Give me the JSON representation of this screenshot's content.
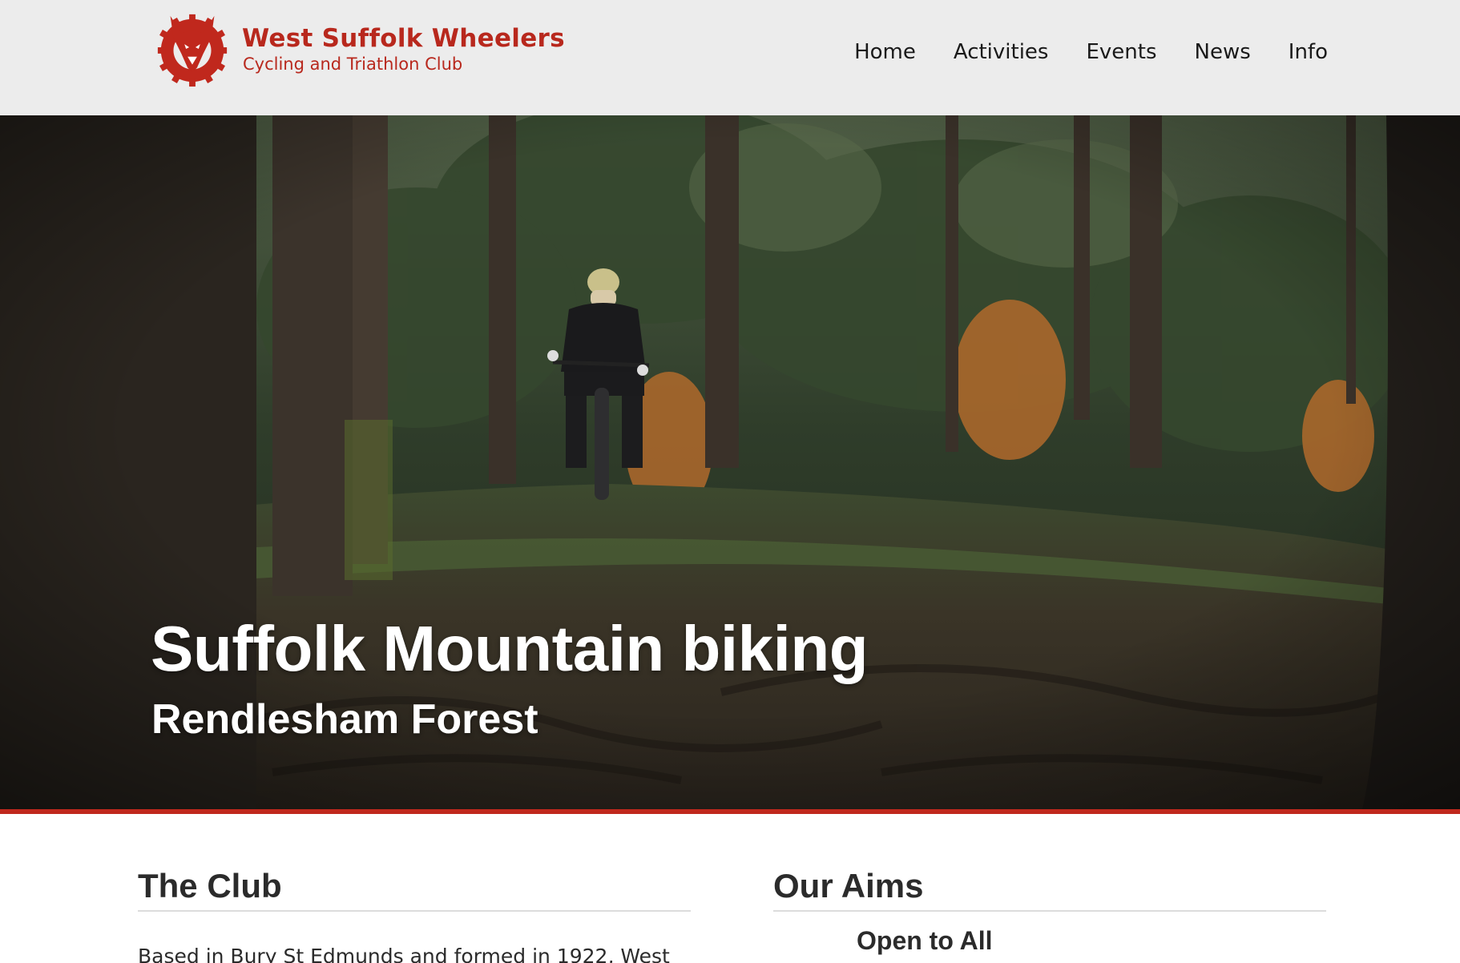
{
  "header": {
    "brand_title": "West Suffolk Wheelers",
    "brand_subtitle": "Cycling and Triathlon Club",
    "nav": [
      "Home",
      "Activities",
      "Events",
      "News",
      "Info"
    ]
  },
  "hero": {
    "title": "Suffolk Mountain biking",
    "subtitle": "Rendlesham Forest",
    "slide_count": 3,
    "active_slide": 1
  },
  "sections": {
    "club": {
      "heading": "The Club",
      "text": "Based in Bury St Edmunds and formed in 1922, West"
    },
    "aims": {
      "heading": "Our Aims",
      "first_aim": "Open to All"
    }
  },
  "colors": {
    "brand_red": "#b8281d",
    "header_bg": "#ececec",
    "accent_bar": "#c0281d"
  },
  "icons": {
    "logo": "fox-head-cog-logo"
  }
}
